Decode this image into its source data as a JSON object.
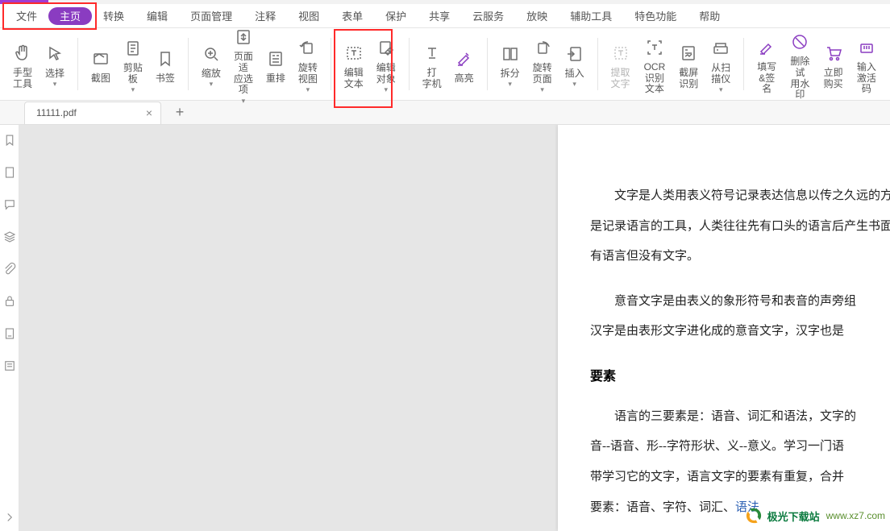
{
  "menu": {
    "items": [
      "文件",
      "主页",
      "转换",
      "编辑",
      "页面管理",
      "注释",
      "视图",
      "表单",
      "保护",
      "共享",
      "云服务",
      "放映",
      "辅助工具",
      "特色功能",
      "帮助"
    ],
    "active_index": 1
  },
  "ribbon": {
    "hand": {
      "label": "手型\n工具"
    },
    "select": {
      "label": "选择",
      "caret": true
    },
    "snip": {
      "label": "截图"
    },
    "clip": {
      "label": "剪贴\n板",
      "caret": true
    },
    "bookmark": {
      "label": "书签"
    },
    "zoom": {
      "label": "缩放",
      "caret": true
    },
    "fit": {
      "label": "页面适\n应选项",
      "caret": true
    },
    "rearr": {
      "label": "重排"
    },
    "rotview": {
      "label": "旋转\n视图",
      "caret": true
    },
    "edtext": {
      "label": "编辑\n文本"
    },
    "edobj": {
      "label": "编辑\n对象",
      "caret": true
    },
    "typewr": {
      "label": "打\n字机"
    },
    "hilite": {
      "label": "高亮"
    },
    "split": {
      "label": "拆分",
      "caret": true
    },
    "rotpage": {
      "label": "旋转\n页面",
      "caret": true
    },
    "insert": {
      "label": "插入",
      "caret": true
    },
    "extract": {
      "label": "提取\n文字",
      "disabled": true
    },
    "ocr": {
      "label": "OCR\n识别文本"
    },
    "scrshot": {
      "label": "截屏\n识别"
    },
    "scanner": {
      "label": "从扫\n描仪",
      "caret": true
    },
    "fillsign": {
      "label": "填写\n&签名"
    },
    "trialwm": {
      "label": "删除试\n用水印"
    },
    "buy": {
      "label": "立即\n购买"
    },
    "activate": {
      "label": "输入\n激活码"
    }
  },
  "tabs": {
    "items": [
      {
        "title": "11111.pdf"
      }
    ]
  },
  "document": {
    "p1": "文字是人类用表义符号记录表达信息以传之久远的方式和工",
    "p2": "是记录语言的工具，人类往往先有口头的语言后产生书面的文字",
    "p3": "有语言但没有文字。",
    "p4": "意音文字是由表义的象形符号和表音的声旁组",
    "p5": "汉字是由表形文字进化成的意音文字，汉字也是",
    "h1": "要素",
    "p6": "语言的三要素是：语音、词汇和语法，文字的",
    "p7": "音--语音、形--字符形状、义--意义。学习一门语",
    "p8": "带学习它的文字，语言文字的要素有重复，合并",
    "p9_a": "要素：语音、字符、词汇、",
    "p9_b": "语法"
  },
  "watermark": {
    "brand": "极光下载站",
    "url": "www.xz7.com"
  }
}
